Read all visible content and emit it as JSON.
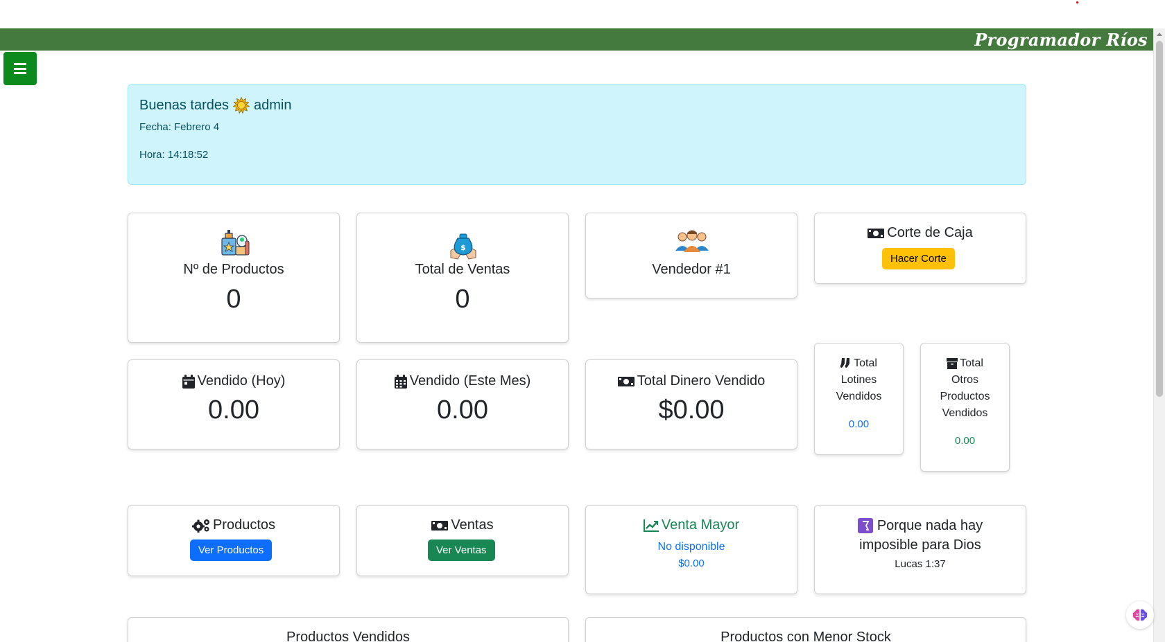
{
  "brand": "Programador Ríos",
  "greeting": {
    "text": "Buenas tardes",
    "user": "admin",
    "fecha": "Fecha: Febrero 4",
    "hora": "Hora: 14:18:52"
  },
  "stats": {
    "productos": {
      "label": "Nº de Productos",
      "value": "0"
    },
    "ventas": {
      "label": "Total de Ventas",
      "value": "0"
    },
    "vendedor": {
      "label": "Vendedor #1"
    },
    "corte": {
      "label": "Corte de Caja",
      "button": "Hacer Corte"
    },
    "vendido_hoy": {
      "label": "Vendido (Hoy)",
      "value": "0.00"
    },
    "vendido_mes": {
      "label": "Vendido (Este Mes)",
      "value": "0.00"
    },
    "dinero": {
      "label": "Total Dinero Vendido",
      "value": "$0.00"
    },
    "lotines": {
      "line1": "Total",
      "line2": "Lotines",
      "line3": "Vendidos",
      "value": "0.00"
    },
    "otros": {
      "line1": "Total",
      "line2": "Otros",
      "line3": "Productos",
      "line4": "Vendidos",
      "value": "0.00"
    }
  },
  "actions": {
    "productos": {
      "label": "Productos",
      "button": "Ver Productos"
    },
    "ventas": {
      "label": "Ventas",
      "button": "Ver Ventas"
    },
    "venta_mayor": {
      "label": "Venta Mayor",
      "name": "No disponible",
      "amount": "$0.00"
    },
    "verse": {
      "line1": "Porque nada hay",
      "line2": "imposible para Dios",
      "ref": "Lucas 1:37"
    }
  },
  "sections": {
    "vendidos": "Productos Vendidos",
    "menor_stock": "Productos con Menor Stock"
  },
  "colors": {
    "topbar": "#447a3d",
    "menu": "#0c8a1e",
    "alert_bg": "#cff4fc",
    "warning": "#ffc107",
    "primary": "#0d6efd",
    "success": "#198754"
  }
}
